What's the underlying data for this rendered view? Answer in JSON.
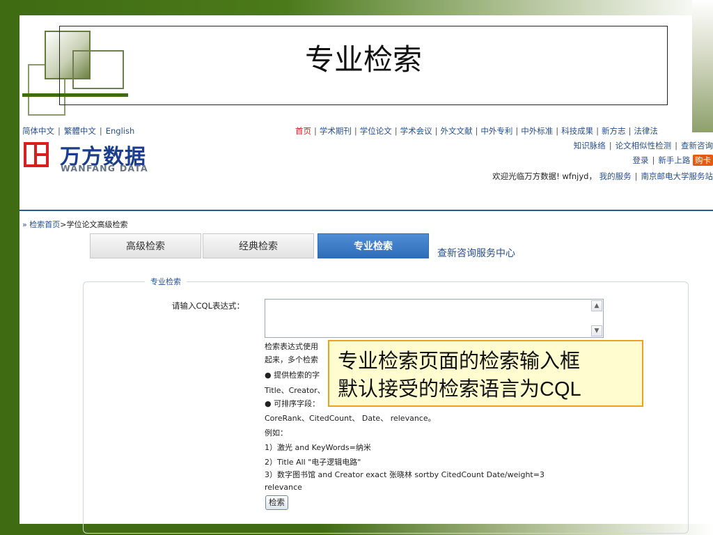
{
  "slide": {
    "title": "专业检索",
    "callout": {
      "line1": "专业检索页面的检索输入框",
      "line2_prefix": "默认接受的检索语言为",
      "line2_cql": "CQL"
    }
  },
  "header": {
    "languages": [
      "简体中文",
      "繁體中文",
      "English"
    ],
    "logo_cn": "万方数据",
    "logo_en": "WANFANG DATA",
    "nav_top": [
      "首页",
      "学术期刊",
      "学位论文",
      "学术会议",
      "外文文献",
      "中外专利",
      "中外标准",
      "科技成果",
      "新方志",
      "法律法"
    ],
    "nav_row2": [
      "知识脉络",
      "论文相似性检测",
      "查新咨询"
    ],
    "nav_row3": {
      "login": "登录",
      "newbie": "新手上路",
      "buy": "购卡"
    },
    "welcome": "欢迎光临万方数据! wfnjyd，",
    "my_service": "我的服务",
    "institution": "南京邮电大学服务站"
  },
  "breadcrumb": {
    "home": "检索首页",
    "current": ">学位论文高级检索"
  },
  "tabs": [
    {
      "label": "高级检索"
    },
    {
      "label": "经典检索"
    },
    {
      "label": "专业检索"
    }
  ],
  "tab_link": "查新咨询服务中心",
  "panel": {
    "legend": "专业检索",
    "input_label": "请输入CQL表达式：",
    "input_value": "",
    "help": [
      "检索表达式使用",
      "起来，多个检索",
      "● 提供检索的字",
      "Title、Creator、",
      "● 可排序字段：",
      "CoreRank、CitedCount、 Date、 relevance。",
      "例如：",
      "1）激光  and KeyWords=纳米",
      "2）Title All \"电子逻辑电路\"",
      "3）数字图书馆  and Creator exact 张晓林  sortby CitedCount Date/weight=3",
      "relevance"
    ],
    "search_button": "检索"
  },
  "icons": {
    "scroll_up": "▲",
    "scroll_down": "▼"
  },
  "colors": {
    "frame_green": "#3f6b12",
    "link_blue": "#2a4f8f",
    "tab_active": "#2e6cb8",
    "logo_red": "#d81e1e",
    "callout_border": "#f0a020"
  }
}
